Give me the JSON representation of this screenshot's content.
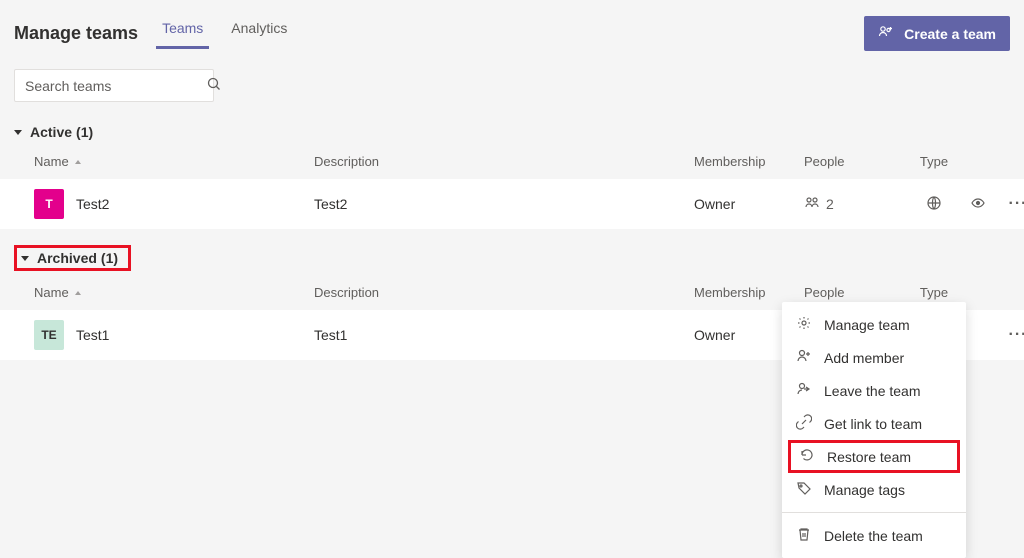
{
  "header": {
    "title": "Manage teams",
    "tabs": [
      "Teams",
      "Analytics"
    ],
    "active_tab": 0,
    "create_button": "Create a team"
  },
  "search": {
    "placeholder": "Search teams"
  },
  "columns": {
    "name": "Name",
    "description": "Description",
    "membership": "Membership",
    "people": "People",
    "type": "Type"
  },
  "groups": {
    "active": {
      "label": "Active",
      "count": 1,
      "suffix": "(1)",
      "rows": [
        {
          "avatar_letters": "T",
          "avatar_class": "avatar-pink",
          "name": "Test2",
          "description": "Test2",
          "membership": "Owner",
          "people": "2",
          "type_icon": "globe"
        }
      ]
    },
    "archived": {
      "label": "Archived",
      "count": 1,
      "suffix": "(1)",
      "rows": [
        {
          "avatar_letters": "TE",
          "avatar_class": "avatar-teal",
          "name": "Test1",
          "description": "Test1",
          "membership": "Owner",
          "people": "",
          "type_icon": ""
        }
      ]
    }
  },
  "context_menu": {
    "items": [
      {
        "icon": "gear",
        "label": "Manage team"
      },
      {
        "icon": "add-member",
        "label": "Add member"
      },
      {
        "icon": "leave",
        "label": "Leave the team"
      },
      {
        "icon": "link",
        "label": "Get link to team"
      },
      {
        "icon": "restore",
        "label": "Restore team",
        "highlighted": true
      },
      {
        "icon": "tag",
        "label": "Manage tags"
      }
    ],
    "delete": {
      "icon": "trash",
      "label": "Delete the team"
    }
  }
}
